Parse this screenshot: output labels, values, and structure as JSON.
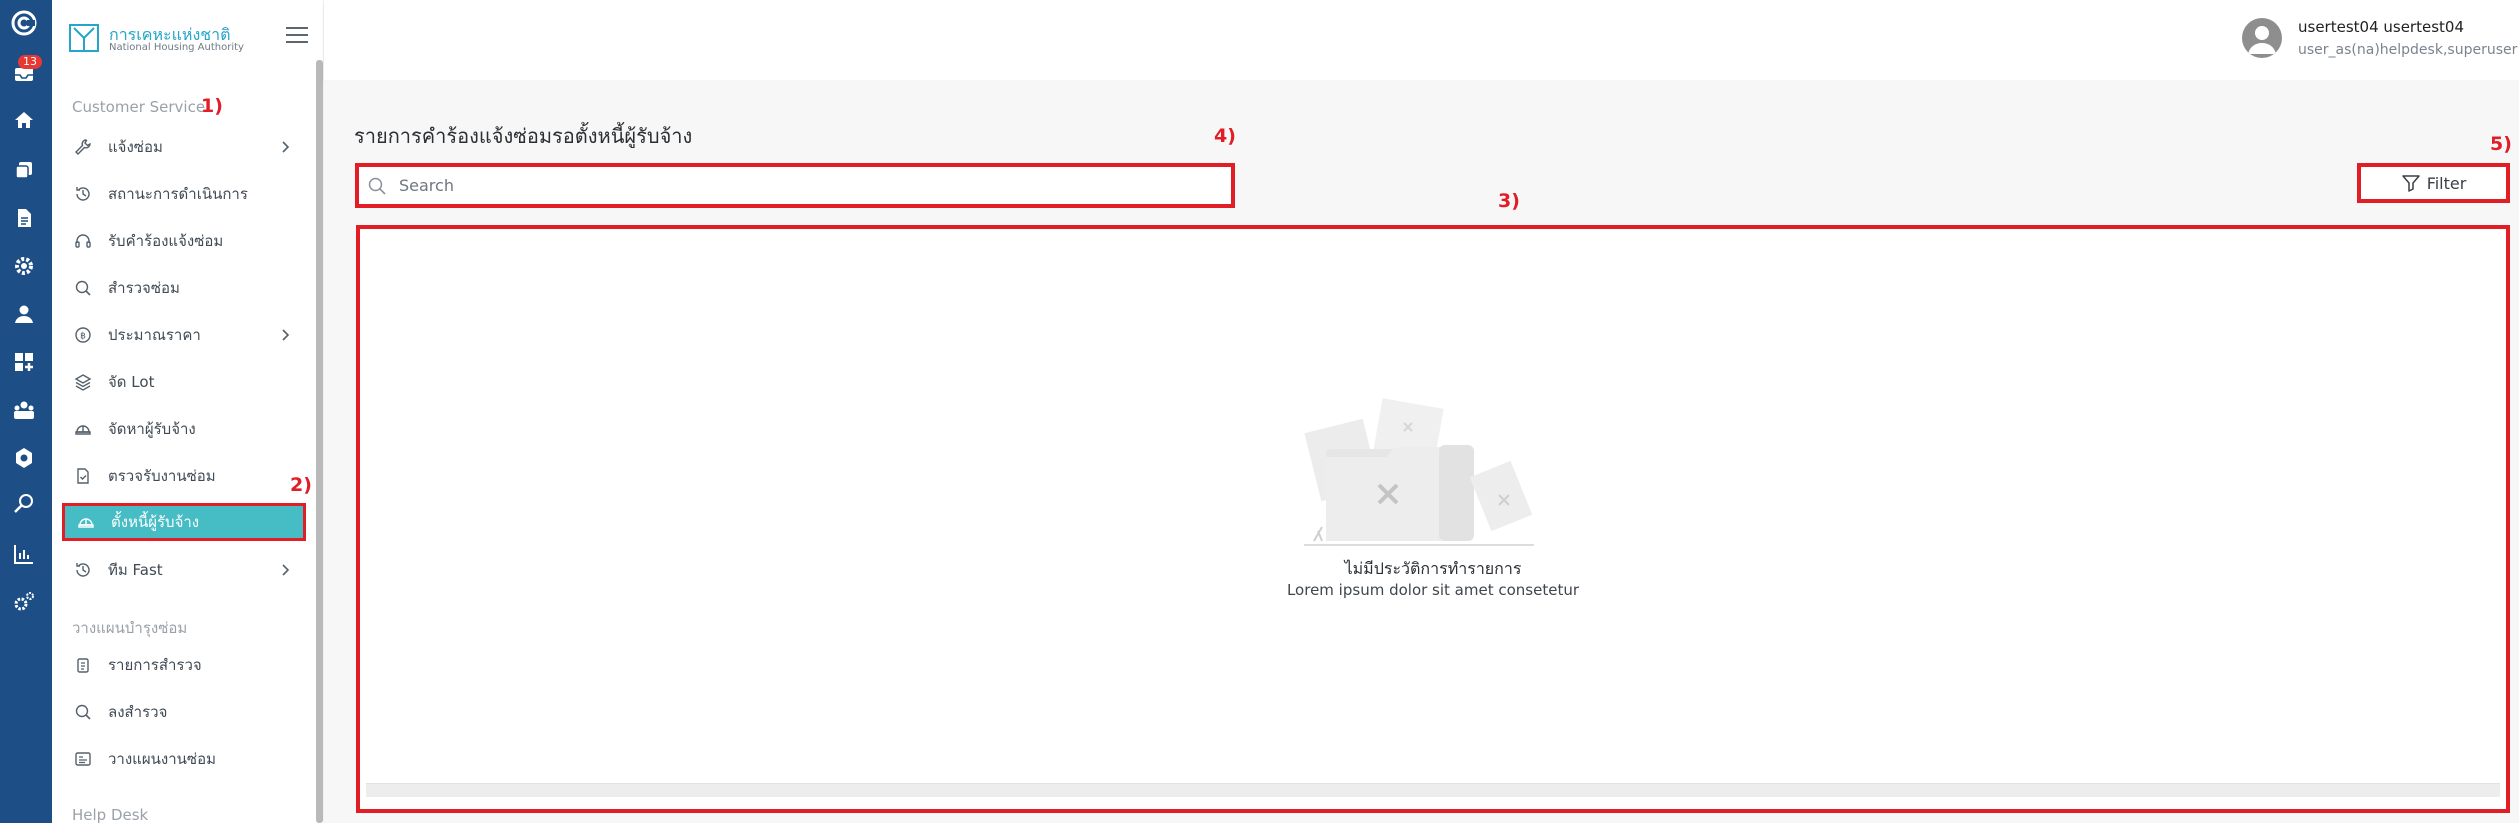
{
  "rail": {
    "badge": "13",
    "icons": [
      "logo-icon",
      "inbox-icon",
      "home-icon",
      "copy-icon",
      "document-icon",
      "gear-icon",
      "user-icon",
      "dashboard-add-icon",
      "team-icon",
      "settings-icon",
      "search-icon",
      "bar-chart-icon",
      "cogs-icon"
    ]
  },
  "brand": {
    "name_th": "การเคหะแห่งชาติ",
    "name_en": "National Housing Authority"
  },
  "sidebar": {
    "section1": "Customer Service",
    "items": [
      {
        "label": "แจ้งซ่อม",
        "icon": "wrench-icon",
        "chevron": true
      },
      {
        "label": "สถานะการดำเนินการ",
        "icon": "history-icon",
        "chevron": false
      },
      {
        "label": "รับคำร้องแจ้งซ่อม",
        "icon": "headset-icon",
        "chevron": false
      },
      {
        "label": "สำรวจซ่อม",
        "icon": "search-icon",
        "chevron": false
      },
      {
        "label": "ประมาณราคา",
        "icon": "baht-icon",
        "chevron": true
      },
      {
        "label": "จัด Lot",
        "icon": "layers-icon",
        "chevron": false
      },
      {
        "label": "จัดหาผู้รับจ้าง",
        "icon": "helmet-icon",
        "chevron": false
      },
      {
        "label": "ตรวจรับงานซ่อม",
        "icon": "doc-check-icon",
        "chevron": false
      },
      {
        "label": "ตั้งหนี้ผู้รับจ้าง",
        "icon": "helmet-icon",
        "chevron": false
      },
      {
        "label": "ทีม Fast",
        "icon": "history-icon",
        "chevron": true
      }
    ],
    "section2": "วางแผนบำรุงซ่อม",
    "items2": [
      {
        "label": "รายการสำรวจ",
        "icon": "clipboard-icon"
      },
      {
        "label": "ลงสำรวจ",
        "icon": "search-icon"
      },
      {
        "label": "วางแผนงานซ่อม",
        "icon": "planner-icon"
      }
    ],
    "section3": "Help Desk"
  },
  "user": {
    "name": "usertest04 usertest04",
    "role": "user_as(na)helpdesk,superuser"
  },
  "page": {
    "title": "รายการคำร้องแจ้งซ่อมรอตั้งหนี้ผู้รับจ้าง",
    "search_placeholder": "Search",
    "filter_label": "Filter",
    "empty_title": "ไม่มีประวัติการทำรายการ",
    "empty_sub": "Lorem ipsum dolor sit amet consetetur"
  },
  "annotations": [
    "1)",
    "2)",
    "3)",
    "4)",
    "5)"
  ],
  "colors": {
    "rail": "#1d4f86",
    "active": "#46bcc4",
    "annotation": "#e11d26",
    "brand": "#25a5c9"
  }
}
